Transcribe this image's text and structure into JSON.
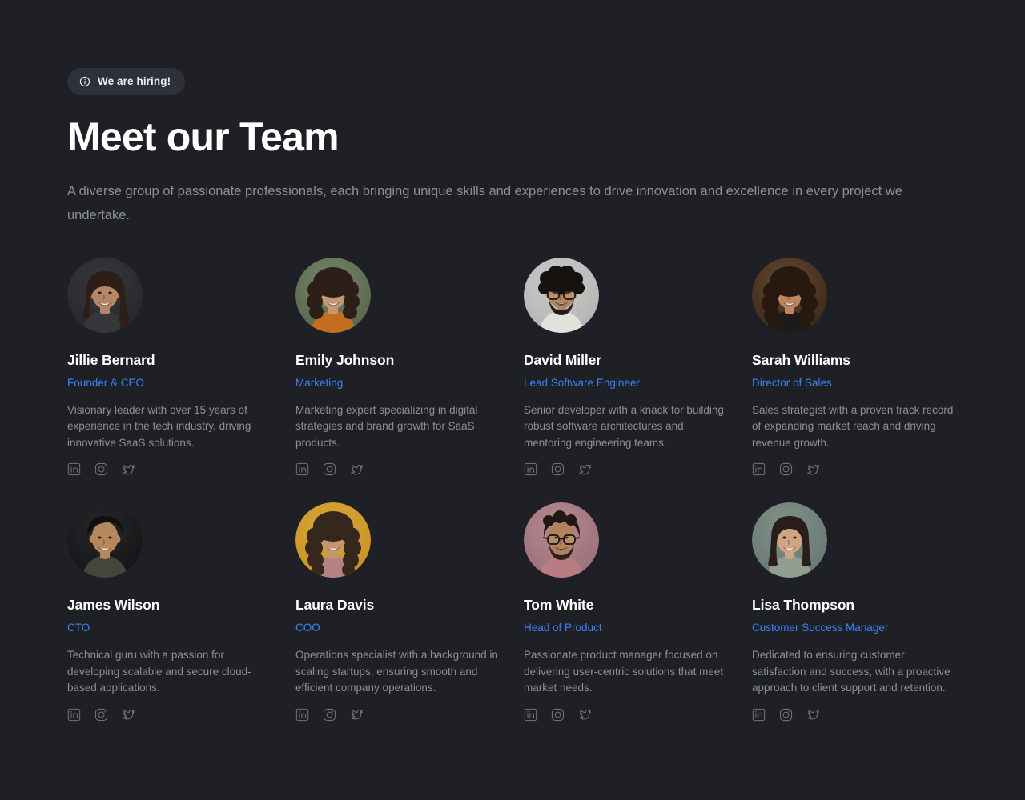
{
  "page": {
    "background_color": "#1e2025",
    "accent_color": "#3b82f6",
    "heading_color": "#ffffff",
    "muted_text_color": "#8b9097"
  },
  "header": {
    "badge": {
      "label": "We are hiring!",
      "icon": "info-circle-icon"
    },
    "title": "Meet our Team",
    "subtitle": "A diverse group of passionate professionals, each bringing unique skills and experiences to drive innovation and excellence in every project we undertake."
  },
  "social_icons": [
    {
      "name": "linkedin-icon",
      "label": "LinkedIn"
    },
    {
      "name": "instagram-icon",
      "label": "Instagram"
    },
    {
      "name": "twitter-icon",
      "label": "Twitter"
    }
  ],
  "team": [
    {
      "name": "Jillie Bernard",
      "role": "Founder & CEO",
      "bio": "Visionary leader with over 15 years of experience in the tech industry, driving innovative SaaS solutions.",
      "avatar": {
        "alt": "Portrait of Jillie Bernard",
        "bg": "#3a3c40",
        "bg2": "#26282c",
        "skin": "#c08f6e",
        "hair": "#30211a",
        "clothes": "#3a3b3e",
        "hair_style": "long-wavy",
        "glasses": false,
        "beard": false
      }
    },
    {
      "name": "Emily Johnson",
      "role": "Marketing",
      "bio": "Marketing expert specializing in digital strategies and brand growth for SaaS products.",
      "avatar": {
        "alt": "Portrait of Emily Johnson",
        "bg": "#7c8d6c",
        "bg2": "#5c6a50",
        "skin": "#d3a07a",
        "hair": "#2e2119",
        "clothes": "#cf7520",
        "hair_style": "curly",
        "glasses": false,
        "beard": false
      }
    },
    {
      "name": "David Miller",
      "role": "Lead Software Engineer",
      "bio": "Senior developer with a knack for building robust software architectures and mentoring engineering teams.",
      "avatar": {
        "alt": "Portrait of David Miller",
        "bg": "#d8d8d6",
        "bg2": "#bdbdbb",
        "skin": "#c28e66",
        "hair": "#181410",
        "clothes": "#f2f0ea",
        "hair_style": "curly-short",
        "glasses": true,
        "beard": true
      }
    },
    {
      "name": "Sarah Williams",
      "role": "Director of Sales",
      "bio": "Sales strategist with a proven track record of expanding market reach and driving revenue growth.",
      "avatar": {
        "alt": "Portrait of Sarah Williams",
        "bg": "#6b4c33",
        "bg2": "#3b2a1c",
        "skin": "#c98f63",
        "hair": "#2a1a12",
        "clothes": "#1e1c1c",
        "hair_style": "long-curly",
        "glasses": false,
        "beard": false
      }
    },
    {
      "name": "James Wilson",
      "role": "CTO",
      "bio": "Technical guru with a passion for developing scalable and secure cloud-based applications.",
      "avatar": {
        "alt": "Portrait of James Wilson",
        "bg": "#2a2a2c",
        "bg2": "#151517",
        "skin": "#c28f63",
        "hair": "#14100e",
        "clothes": "#4a4a40",
        "hair_style": "short",
        "glasses": false,
        "beard": false
      }
    },
    {
      "name": "Laura Davis",
      "role": "COO",
      "bio": "Operations specialist with a background in scaling startups, ensuring smooth and efficient company operations.",
      "avatar": {
        "alt": "Portrait of Laura Davis",
        "bg": "#e8b13c",
        "bg2": "#d69a26",
        "skin": "#d2a176",
        "hair": "#3a2a1e",
        "clothes": "#c08b8d",
        "hair_style": "long-curly",
        "glasses": false,
        "beard": false
      }
    },
    {
      "name": "Tom White",
      "role": "Head of Product",
      "bio": "Passionate product manager focused on delivering user-centric solutions that meet market needs.",
      "avatar": {
        "alt": "Portrait of Tom White",
        "bg": "#c1929c",
        "bg2": "#a3757f",
        "skin": "#c08a63",
        "hair": "#241a14",
        "clothes": "#c4848c",
        "hair_style": "short-wavy",
        "glasses": true,
        "beard": true
      }
    },
    {
      "name": "Lisa Thompson",
      "role": "Customer Success Manager",
      "bio": "Dedicated to ensuring customer satisfaction and success, with a proactive approach to client support and retention.",
      "avatar": {
        "alt": "Portrait of Lisa Thompson",
        "bg": "#8b9a94",
        "bg2": "#6d7d77",
        "skin": "#dcb08c",
        "hair": "#2b211c",
        "clothes": "#9aa89c",
        "hair_style": "long-straight",
        "glasses": false,
        "beard": false
      }
    }
  ]
}
